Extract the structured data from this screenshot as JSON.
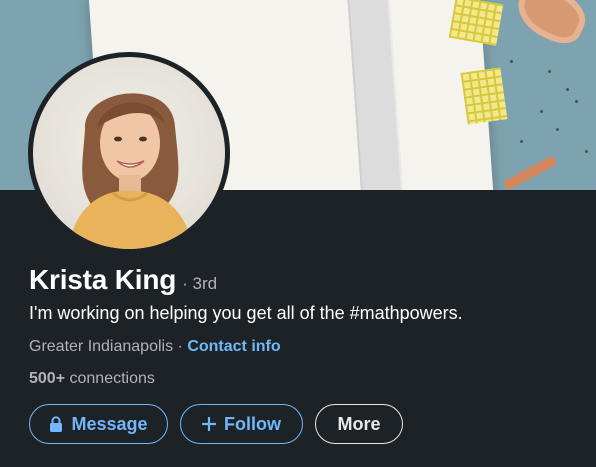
{
  "profile": {
    "name": "Krista King",
    "degree": "· 3rd",
    "headline": "I'm working on helping you get all of the #mathpowers.",
    "location": "Greater Indianapolis",
    "separator": "·",
    "contact_label": "Contact info",
    "connections_count": "500+",
    "connections_label": "connections"
  },
  "actions": {
    "message_label": "Message",
    "follow_label": "Follow",
    "more_label": "More"
  },
  "icons": {
    "message": "lock-icon",
    "follow": "plus-icon"
  },
  "colors": {
    "background": "#1d2226",
    "accent_blue": "#71b7fb",
    "text_primary": "#ffffff",
    "text_secondary": "#b0b3b8"
  }
}
